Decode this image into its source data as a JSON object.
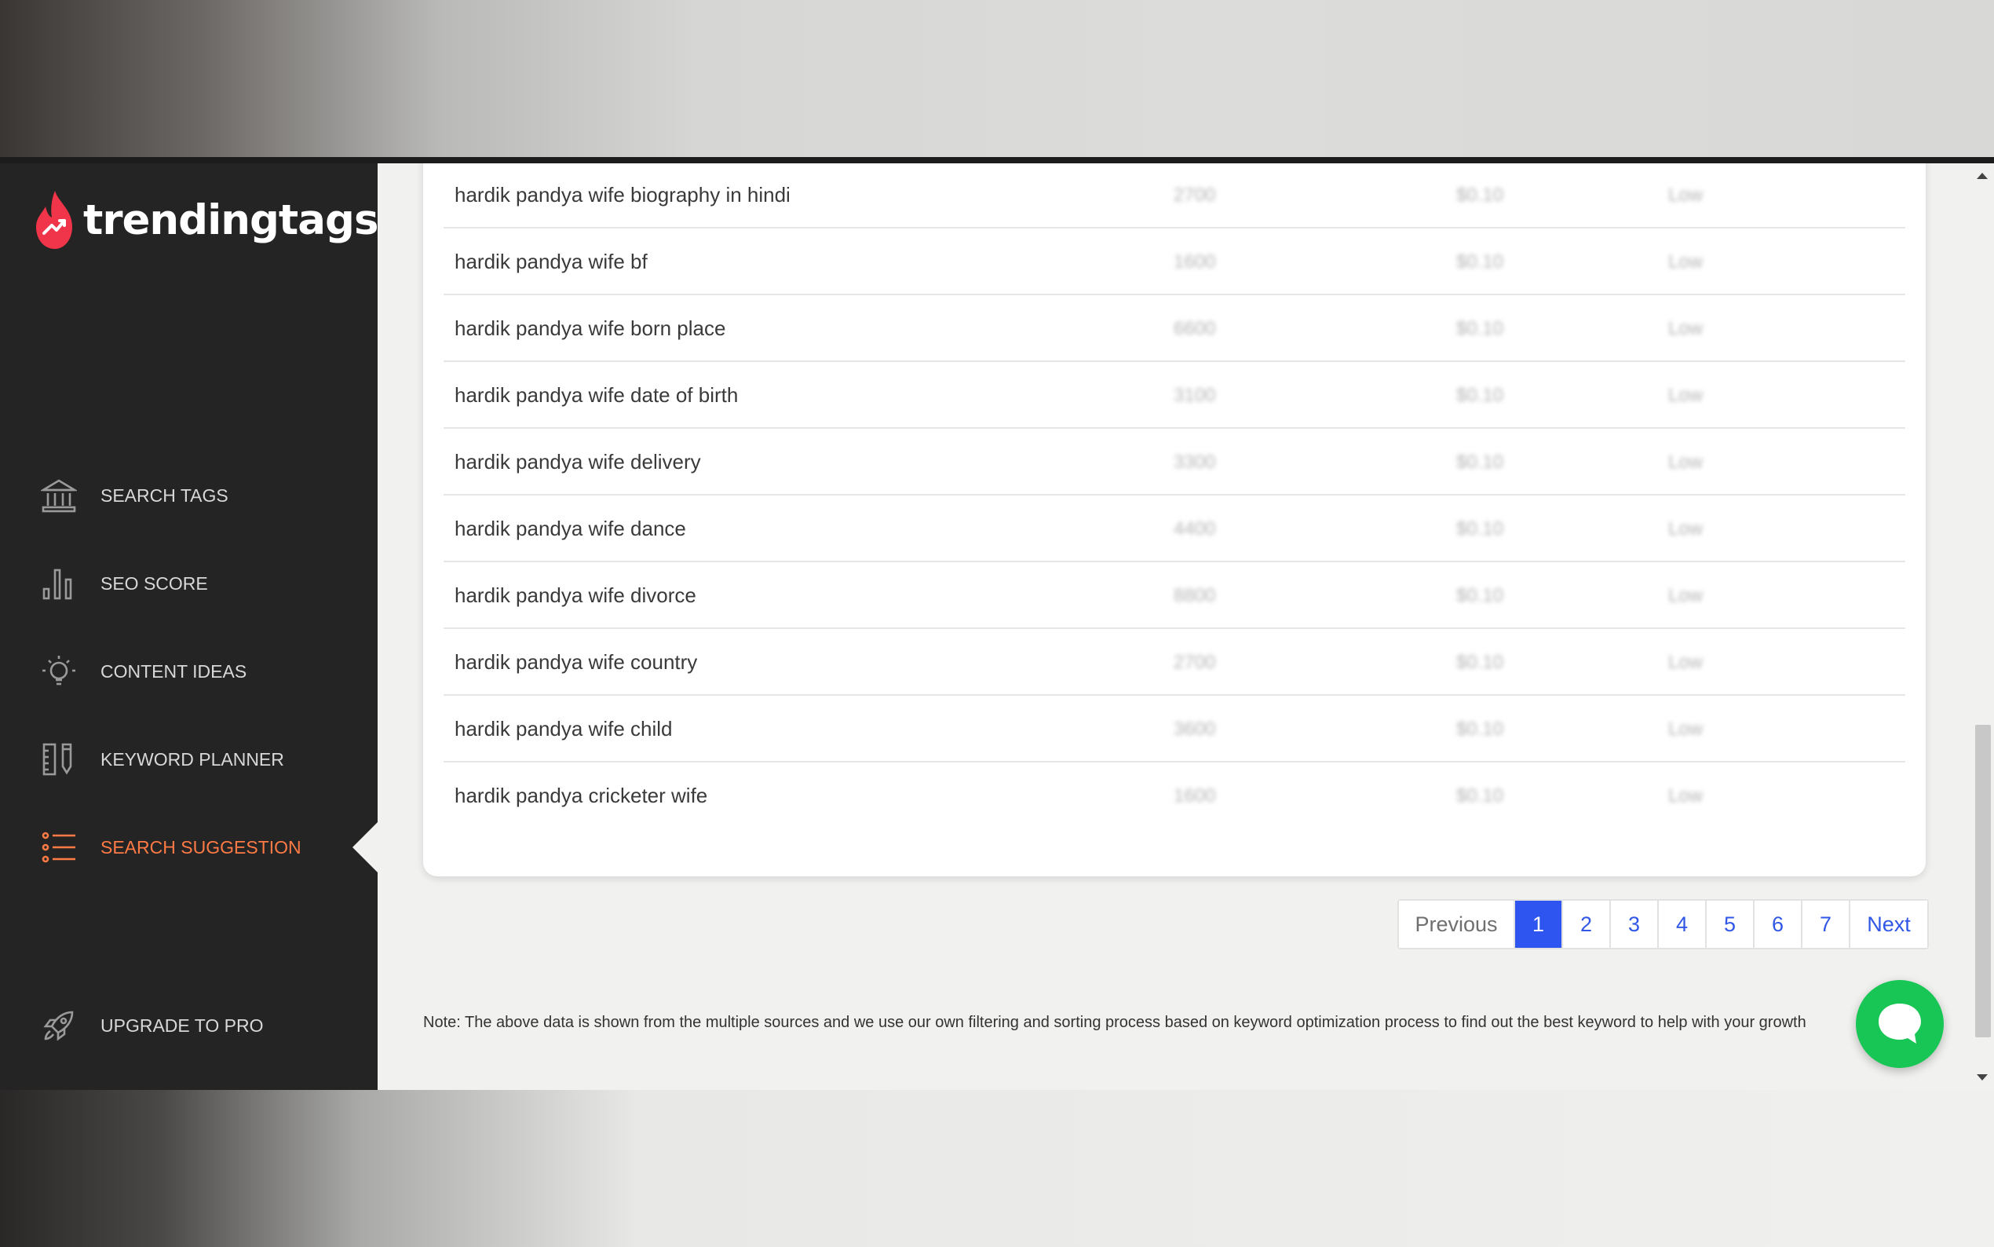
{
  "brand": {
    "name": "trendingtags"
  },
  "sidebar": {
    "items": [
      {
        "label": "SEARCH TAGS",
        "icon": "bank-icon"
      },
      {
        "label": "SEO SCORE",
        "icon": "bar-chart-icon"
      },
      {
        "label": "CONTENT IDEAS",
        "icon": "lightbulb-icon"
      },
      {
        "label": "KEYWORD PLANNER",
        "icon": "ruler-pencil-icon"
      },
      {
        "label": "SEARCH SUGGESTION",
        "icon": "list-icon",
        "active": true
      }
    ],
    "upgrade": {
      "label": "UPGRADE TO PRO",
      "icon": "rocket-icon"
    }
  },
  "table": {
    "rows": [
      {
        "keyword": "hardik pandya wife biography in hindi",
        "volume": "2700",
        "cpc": "$0.10",
        "competition": "Low"
      },
      {
        "keyword": "hardik pandya wife bf",
        "volume": "1600",
        "cpc": "$0.10",
        "competition": "Low"
      },
      {
        "keyword": "hardik pandya wife born place",
        "volume": "6600",
        "cpc": "$0.10",
        "competition": "Low"
      },
      {
        "keyword": "hardik pandya wife date of birth",
        "volume": "3100",
        "cpc": "$0.10",
        "competition": "Low"
      },
      {
        "keyword": "hardik pandya wife delivery",
        "volume": "3300",
        "cpc": "$0.10",
        "competition": "Low"
      },
      {
        "keyword": "hardik pandya wife dance",
        "volume": "4400",
        "cpc": "$0.10",
        "competition": "Low"
      },
      {
        "keyword": "hardik pandya wife divorce",
        "volume": "8800",
        "cpc": "$0.10",
        "competition": "Low"
      },
      {
        "keyword": "hardik pandya wife country",
        "volume": "2700",
        "cpc": "$0.10",
        "competition": "Low"
      },
      {
        "keyword": "hardik pandya wife child",
        "volume": "3600",
        "cpc": "$0.10",
        "competition": "Low"
      },
      {
        "keyword": "hardik pandya cricketer wife",
        "volume": "1600",
        "cpc": "$0.10",
        "competition": "Low"
      }
    ]
  },
  "pagination": {
    "previous": "Previous",
    "pages": [
      "1",
      "2",
      "3",
      "4",
      "5",
      "6",
      "7"
    ],
    "current": "1",
    "next": "Next"
  },
  "note": "Note: The above data is shown from the multiple sources and we use our own filtering and sorting process based on keyword optimization process to find out the best keyword to help with your growth",
  "colors": {
    "sidebar_bg": "#242424",
    "accent": "#ff7a45",
    "page_active": "#2f55f0",
    "chat": "#17c654"
  },
  "chat": {
    "icon": "chat-bubble-icon"
  }
}
